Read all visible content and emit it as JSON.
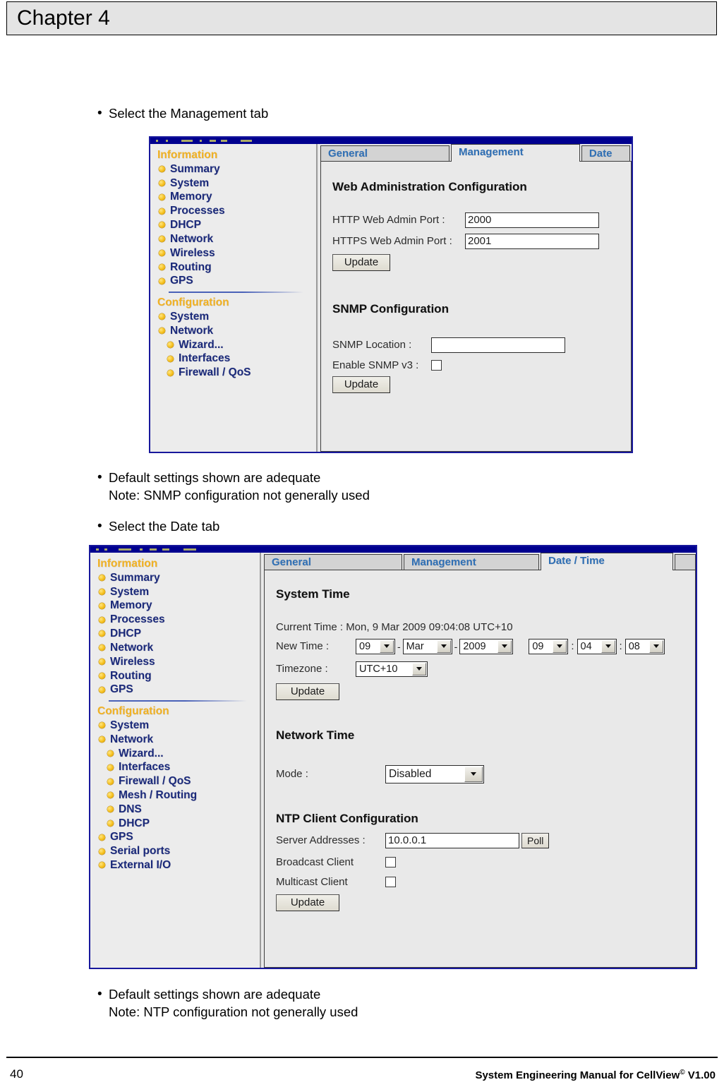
{
  "page": {
    "chapter_title": "Chapter 4",
    "page_number": "40",
    "footer_text_before": "System Engineering Manual for CellView",
    "footer_superscript": "©",
    "footer_text_after": " V1.00"
  },
  "bullets": {
    "b1": "Select the Management tab",
    "b2": "Default settings shown are adequate\nNote: SNMP configuration not generally used",
    "b3": "Select the Date tab",
    "b4": "Default settings shown are adequate\nNote: NTP configuration not generally used"
  },
  "screenshot1": {
    "sidebar": {
      "group1_label": "Information",
      "group1_items": [
        {
          "label": "Summary"
        },
        {
          "label": "System"
        },
        {
          "label": "Memory"
        },
        {
          "label": "Processes"
        },
        {
          "label": "DHCP"
        },
        {
          "label": "Network"
        },
        {
          "label": "Wireless"
        },
        {
          "label": "Routing"
        },
        {
          "label": "GPS"
        }
      ],
      "group2_label": "Configuration",
      "group2_items": [
        {
          "label": "System",
          "indent": false
        },
        {
          "label": "Network",
          "indent": false
        },
        {
          "label": "Wizard...",
          "indent": true
        },
        {
          "label": "Interfaces",
          "indent": true
        },
        {
          "label": "Firewall / QoS",
          "indent": true
        }
      ]
    },
    "tabs": [
      {
        "label": "General",
        "active": false
      },
      {
        "label": "Management",
        "active": true
      },
      {
        "label": "Date",
        "active": false
      }
    ],
    "web_admin": {
      "title": "Web Administration Configuration",
      "http_port_label": "HTTP Web Admin Port :",
      "http_port_value": "2000",
      "https_port_label": "HTTPS Web Admin Port :",
      "https_port_value": "2001",
      "update_label": "Update"
    },
    "snmp": {
      "title": "SNMP Configuration",
      "location_label": "SNMP Location :",
      "location_value": "",
      "enable_v3_label": "Enable SNMP v3 :",
      "enable_v3_checked": false,
      "update_label": "Update"
    }
  },
  "screenshot2": {
    "sidebar": {
      "group1_label": "Information",
      "group1_items": [
        {
          "label": "Summary"
        },
        {
          "label": "System"
        },
        {
          "label": "Memory"
        },
        {
          "label": "Processes"
        },
        {
          "label": "DHCP"
        },
        {
          "label": "Network"
        },
        {
          "label": "Wireless"
        },
        {
          "label": "Routing"
        },
        {
          "label": "GPS"
        }
      ],
      "group2_label": "Configuration",
      "group2_items": [
        {
          "label": "System",
          "indent": false
        },
        {
          "label": "Network",
          "indent": false
        },
        {
          "label": "Wizard...",
          "indent": true
        },
        {
          "label": "Interfaces",
          "indent": true
        },
        {
          "label": "Firewall / QoS",
          "indent": true
        },
        {
          "label": "Mesh / Routing",
          "indent": true
        },
        {
          "label": "DNS",
          "indent": true
        },
        {
          "label": "DHCP",
          "indent": true
        },
        {
          "label": "GPS",
          "indent": false
        },
        {
          "label": "Serial ports",
          "indent": false
        },
        {
          "label": "External I/O",
          "indent": false
        }
      ]
    },
    "tabs": [
      {
        "label": "General",
        "active": false
      },
      {
        "label": "Management",
        "active": false
      },
      {
        "label": "Date / Time",
        "active": true
      }
    ],
    "system_time": {
      "title": "System Time",
      "current_time_label": "Current Time : Mon, 9 Mar 2009 09:04:08 UTC+10",
      "new_time_label": "New Time :",
      "day": "09",
      "month": "Mar",
      "year": "2009",
      "hour": "09",
      "minute": "04",
      "second": "08",
      "timezone_label": "Timezone :",
      "timezone_value": "UTC+10",
      "update_label": "Update",
      "dash": "-",
      "colon": ":"
    },
    "network_time": {
      "title": "Network Time",
      "mode_label": "Mode :",
      "mode_value": "Disabled"
    },
    "ntp": {
      "title": "NTP Client Configuration",
      "server_label": "Server Addresses :",
      "server_value": "10.0.0.1",
      "poll_label": "Poll",
      "broadcast_label": "Broadcast Client",
      "broadcast_checked": false,
      "multicast_label": "Multicast Client",
      "multicast_checked": false,
      "update_label": "Update"
    }
  }
}
